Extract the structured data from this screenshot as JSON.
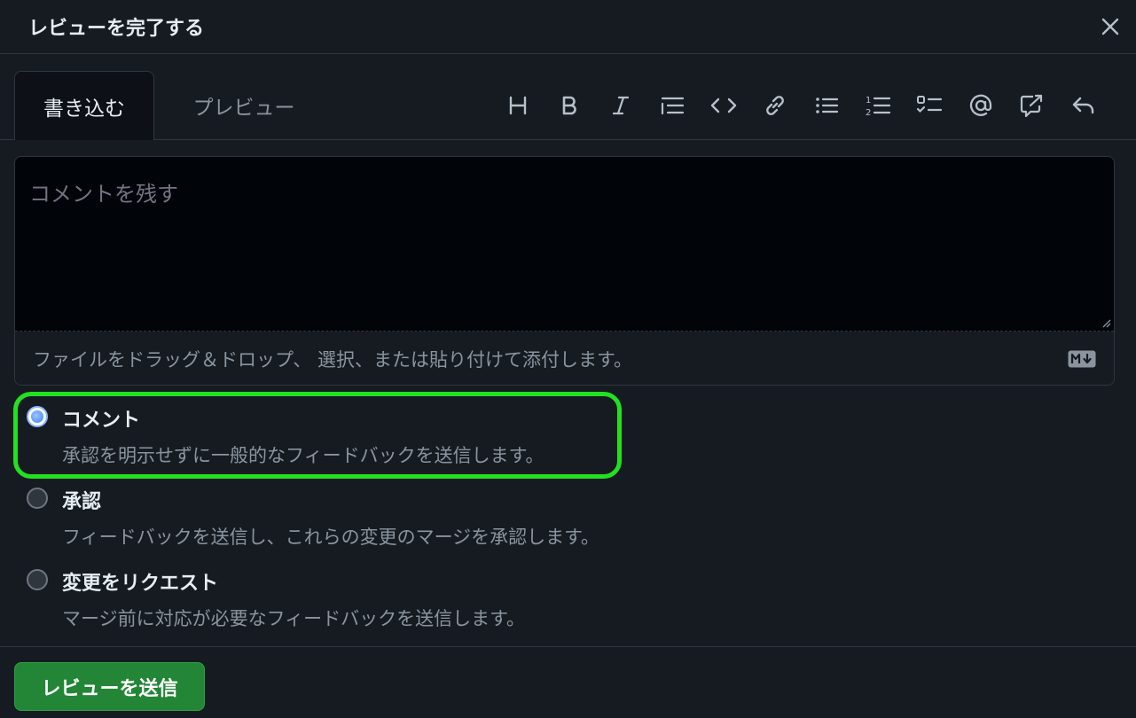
{
  "header": {
    "title": "レビューを完了する",
    "close_icon": "close-icon"
  },
  "tabs": [
    {
      "label": "書き込む",
      "selected": true
    },
    {
      "label": "プレビュー",
      "selected": false
    }
  ],
  "toolbar": {
    "icons": [
      "heading-icon",
      "bold-icon",
      "italic-icon",
      "quote-icon",
      "code-icon",
      "link-icon",
      "bulleted-list-icon",
      "numbered-list-icon",
      "task-list-icon",
      "mention-icon",
      "reference-icon",
      "reply-icon"
    ]
  },
  "editor": {
    "placeholder": "コメントを残す",
    "dropzone_text": "ファイルをドラッグ＆ドロップ、 選択、または貼り付けて添付します。",
    "markdown_icon": "markdown-icon"
  },
  "options": [
    {
      "label": "コメント",
      "description": "承認を明示せずに一般的なフィードバックを送信します。",
      "checked": true
    },
    {
      "label": "承認",
      "description": "フィードバックを送信し、これらの変更のマージを承認します。",
      "checked": false
    },
    {
      "label": "変更をリクエスト",
      "description": "マージ前に対応が必要なフィードバックを送信します。",
      "checked": false
    }
  ],
  "footer": {
    "submit_label": "レビューを送信"
  },
  "colors": {
    "background": "#161b22",
    "accent_green": "#238636",
    "highlight": "#22e022"
  }
}
